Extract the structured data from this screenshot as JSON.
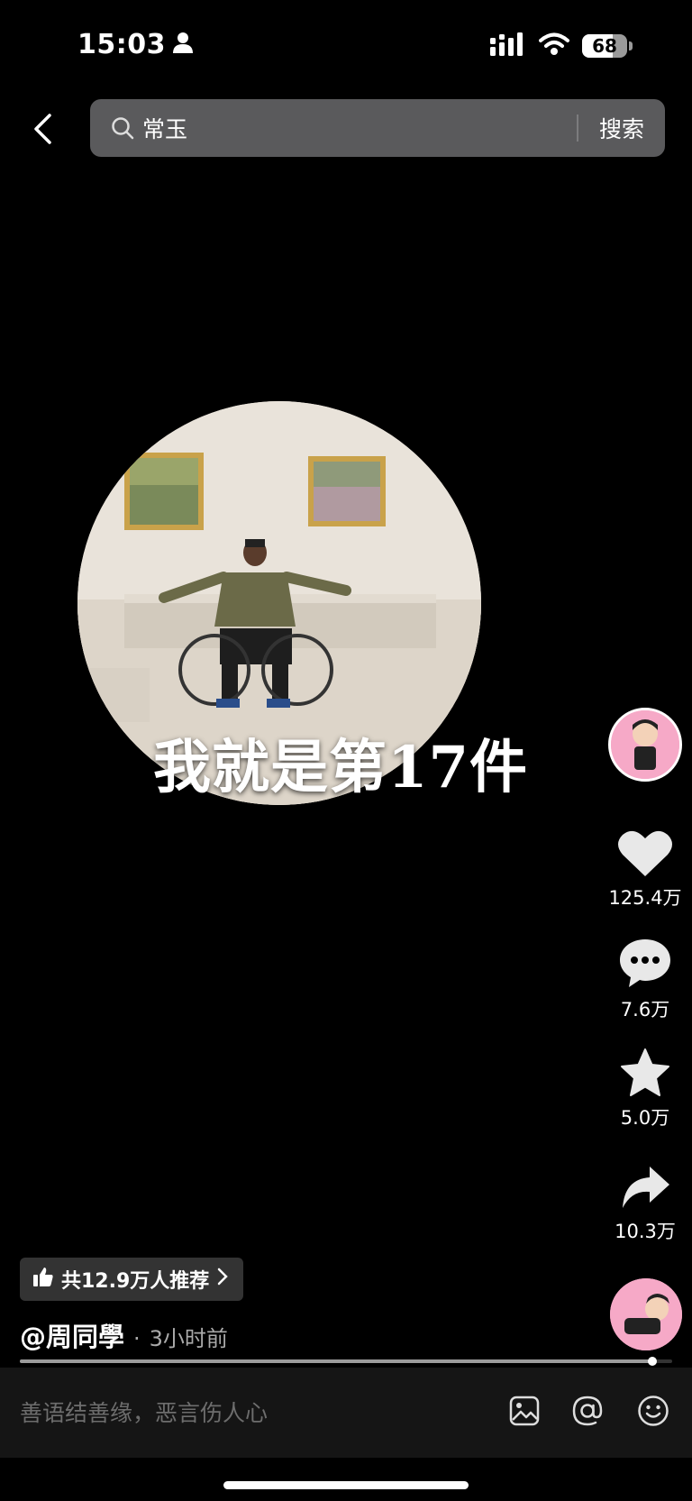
{
  "status_bar": {
    "time": "15:03",
    "battery": "68",
    "battery_level": 0.68
  },
  "search": {
    "query": "常玉",
    "submit_label": "搜索"
  },
  "video": {
    "caption": "我就是第17件"
  },
  "actions": {
    "likes": "125.4万",
    "comments": "7.6万",
    "favorites": "5.0万",
    "shares": "10.3万"
  },
  "info": {
    "recommend": "共12.9万人推荐",
    "author": "@周同學",
    "separator": "·",
    "posted": "3小时前"
  },
  "progress": {
    "played_fraction": 0.97
  },
  "comment_bar": {
    "placeholder": "善语结善缘，恶言伤人心"
  },
  "colors": {
    "background": "#000000",
    "search_bg": "#5a5a5c",
    "avatar_bg": "#f6a9c7",
    "comment_bar_bg": "#151515"
  }
}
